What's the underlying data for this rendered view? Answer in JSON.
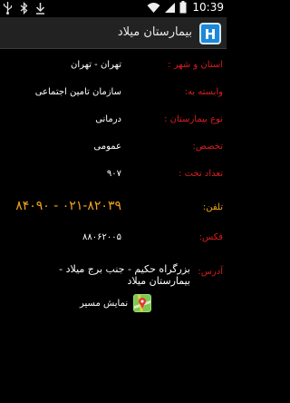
{
  "status_bar": {
    "time": "10:39",
    "icons": [
      "usb-icon",
      "bluetooth-icon",
      "wifi-icon",
      "signal-icon",
      "battery-icon"
    ]
  },
  "app_bar": {
    "title": "بیمارستان میلاد",
    "logo_letter": "H",
    "logo_color": "#1e88d8"
  },
  "details": {
    "province_label": "استان و شهر :",
    "province_value": "تهران - تهران",
    "affiliation_label": "وابسته به:",
    "affiliation_value": "سازمان تامین اجتماعی",
    "type_label": "نوع بیمارستان :",
    "type_value": "درمانی",
    "specialty_label": "تخصص:",
    "specialty_value": "عمومی",
    "beds_label": "تعداد تخت :",
    "beds_value": "۹۰۷",
    "phone_label": "تلفن:",
    "phone_value": "۰۲۱-۸۲۰۳۹ - ۸۴۰۹۰",
    "fax_label": "فکس:",
    "fax_value": "۸۸۰۶۲۰۰۵",
    "address_label": "آدرس:",
    "address_value": "بزرگراه حکیم - جنب برج میلاد - بیمارستان میلاد",
    "route_label": "نمایش مسیر"
  },
  "colors": {
    "label_red": "#d81e1e",
    "label_orange": "#e8a21a",
    "value_orange": "#f3a31b"
  }
}
